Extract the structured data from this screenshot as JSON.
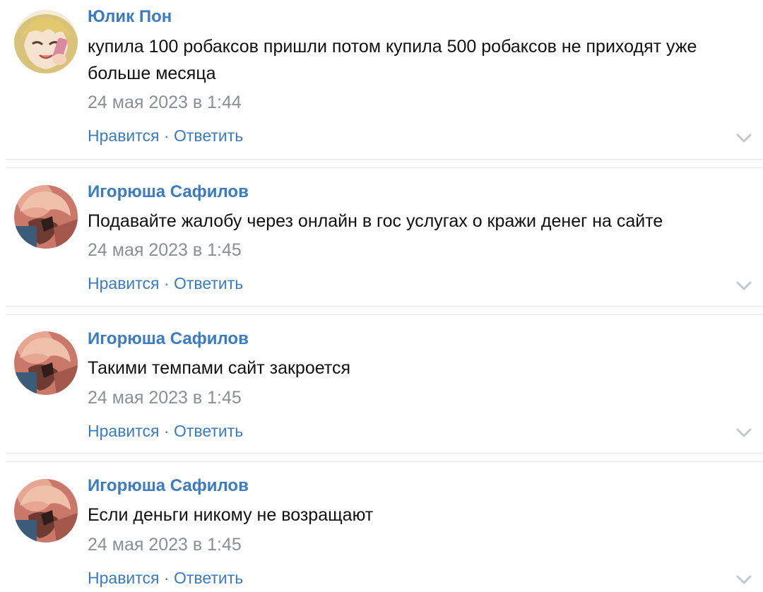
{
  "comments": [
    {
      "author": "Юлик Пон",
      "text": "купила 100 робаксов пришли потом купила 500 робаксов не приходят уже больше месяца",
      "date": "24 мая 2023 в 1:44",
      "like_label": "Нравится",
      "separator": " · ",
      "reply_label": "Ответить",
      "avatar_icon": "anime-girl-phone-avatar",
      "chevron_icon": "chevron-down-icon"
    },
    {
      "author": "Игорюша Сафилов",
      "text": "Подавайте жалобу через онлайн в гос услугах о кражи денег на сайте",
      "date": "24 мая 2023 в 1:45",
      "like_label": "Нравится",
      "separator": " · ",
      "reply_label": "Ответить",
      "avatar_icon": "anime-character-avatar",
      "chevron_icon": "chevron-down-icon"
    },
    {
      "author": "Игорюша Сафилов",
      "text": "Такими темпами сайт закроется",
      "date": "24 мая 2023 в 1:45",
      "like_label": "Нравится",
      "separator": " · ",
      "reply_label": "Ответить",
      "avatar_icon": "anime-character-avatar",
      "chevron_icon": "chevron-down-icon"
    },
    {
      "author": "Игорюша Сафилов",
      "text": "Если деньги никому не возращают",
      "date": "24 мая 2023 в 1:45",
      "like_label": "Нравится",
      "separator": " · ",
      "reply_label": "Ответить",
      "avatar_icon": "anime-character-avatar",
      "chevron_icon": "chevron-down-icon"
    }
  ],
  "colors": {
    "link": "#3a7bc2",
    "text": "#111111",
    "meta": "#8a8f96",
    "divider": "#e3e5e8"
  }
}
